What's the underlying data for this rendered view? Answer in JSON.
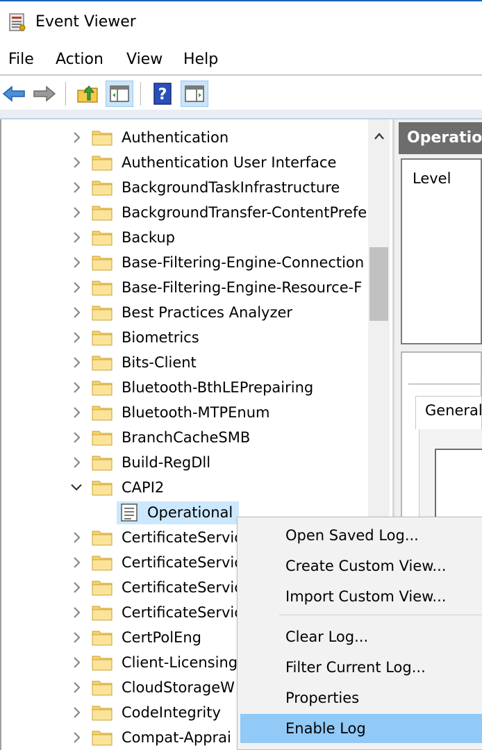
{
  "window": {
    "title": "Event Viewer"
  },
  "menu": [
    "File",
    "Action",
    "View",
    "Help"
  ],
  "toolbar": {
    "buttons": [
      "back-arrow-icon",
      "forward-arrow-icon",
      "up-folder-icon",
      "show-hide-tree-icon",
      "help-icon",
      "show-hide-action-pane-icon"
    ]
  },
  "tree": {
    "items": [
      {
        "label": "Authentication",
        "expanded": false
      },
      {
        "label": "Authentication User Interface",
        "expanded": false
      },
      {
        "label": "BackgroundTaskInfrastructure",
        "expanded": false
      },
      {
        "label": "BackgroundTransfer-ContentPrefe",
        "expanded": false
      },
      {
        "label": "Backup",
        "expanded": false
      },
      {
        "label": "Base-Filtering-Engine-Connection",
        "expanded": false
      },
      {
        "label": "Base-Filtering-Engine-Resource-F",
        "expanded": false
      },
      {
        "label": "Best Practices Analyzer",
        "expanded": false
      },
      {
        "label": "Biometrics",
        "expanded": false
      },
      {
        "label": "Bits-Client",
        "expanded": false
      },
      {
        "label": "Bluetooth-BthLEPrepairing",
        "expanded": false
      },
      {
        "label": "Bluetooth-MTPEnum",
        "expanded": false
      },
      {
        "label": "BranchCacheSMB",
        "expanded": false
      },
      {
        "label": "Build-RegDll",
        "expanded": false
      },
      {
        "label": "CAPI2",
        "expanded": true
      },
      {
        "label": "Operational",
        "child": true,
        "selected": true
      },
      {
        "label": "CertificateServic",
        "expanded": false
      },
      {
        "label": "CertificateServic",
        "expanded": false
      },
      {
        "label": "CertificateServic",
        "expanded": false
      },
      {
        "label": "CertificateServic",
        "expanded": false
      },
      {
        "label": "CertPolEng",
        "expanded": false
      },
      {
        "label": "Client-Licensing",
        "expanded": false
      },
      {
        "label": "CloudStorageW",
        "expanded": false
      },
      {
        "label": "CodeIntegrity",
        "expanded": false
      },
      {
        "label": "Compat-Apprai",
        "expanded": false
      }
    ]
  },
  "right_pane": {
    "header": "Operation",
    "column_level": "Level",
    "tab_general": "General"
  },
  "context_menu": {
    "items": [
      {
        "label": "Open Saved Log...",
        "hover": false
      },
      {
        "label": "Create Custom View...",
        "hover": false
      },
      {
        "label": "Import Custom View...",
        "hover": false
      },
      {
        "separator": true
      },
      {
        "label": "Clear Log...",
        "hover": false
      },
      {
        "label": "Filter Current Log...",
        "hover": false
      },
      {
        "label": "Properties",
        "hover": false
      },
      {
        "label": "Enable Log",
        "hover": true
      }
    ]
  },
  "colors": {
    "selection": "#cce8ff",
    "menu_hover": "#91c9f7",
    "header_gray": "#6d6d6d",
    "folder_yellow": "#f6d26b"
  }
}
